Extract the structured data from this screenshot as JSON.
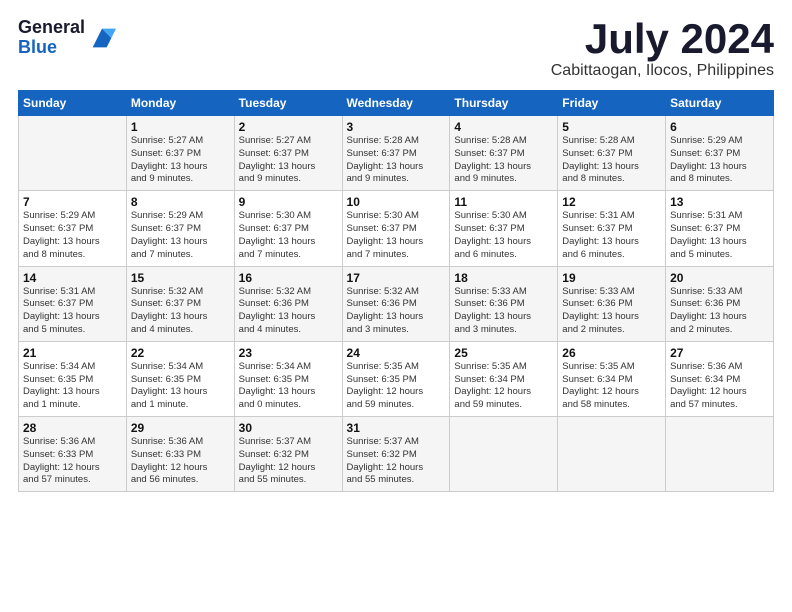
{
  "logo": {
    "general": "General",
    "blue": "Blue"
  },
  "title": "July 2024",
  "subtitle": "Cabittaogan, Ilocos, Philippines",
  "headers": [
    "Sunday",
    "Monday",
    "Tuesday",
    "Wednesday",
    "Thursday",
    "Friday",
    "Saturday"
  ],
  "weeks": [
    [
      {
        "num": "",
        "lines": []
      },
      {
        "num": "1",
        "lines": [
          "Sunrise: 5:27 AM",
          "Sunset: 6:37 PM",
          "Daylight: 13 hours",
          "and 9 minutes."
        ]
      },
      {
        "num": "2",
        "lines": [
          "Sunrise: 5:27 AM",
          "Sunset: 6:37 PM",
          "Daylight: 13 hours",
          "and 9 minutes."
        ]
      },
      {
        "num": "3",
        "lines": [
          "Sunrise: 5:28 AM",
          "Sunset: 6:37 PM",
          "Daylight: 13 hours",
          "and 9 minutes."
        ]
      },
      {
        "num": "4",
        "lines": [
          "Sunrise: 5:28 AM",
          "Sunset: 6:37 PM",
          "Daylight: 13 hours",
          "and 9 minutes."
        ]
      },
      {
        "num": "5",
        "lines": [
          "Sunrise: 5:28 AM",
          "Sunset: 6:37 PM",
          "Daylight: 13 hours",
          "and 8 minutes."
        ]
      },
      {
        "num": "6",
        "lines": [
          "Sunrise: 5:29 AM",
          "Sunset: 6:37 PM",
          "Daylight: 13 hours",
          "and 8 minutes."
        ]
      }
    ],
    [
      {
        "num": "7",
        "lines": [
          "Sunrise: 5:29 AM",
          "Sunset: 6:37 PM",
          "Daylight: 13 hours",
          "and 8 minutes."
        ]
      },
      {
        "num": "8",
        "lines": [
          "Sunrise: 5:29 AM",
          "Sunset: 6:37 PM",
          "Daylight: 13 hours",
          "and 7 minutes."
        ]
      },
      {
        "num": "9",
        "lines": [
          "Sunrise: 5:30 AM",
          "Sunset: 6:37 PM",
          "Daylight: 13 hours",
          "and 7 minutes."
        ]
      },
      {
        "num": "10",
        "lines": [
          "Sunrise: 5:30 AM",
          "Sunset: 6:37 PM",
          "Daylight: 13 hours",
          "and 7 minutes."
        ]
      },
      {
        "num": "11",
        "lines": [
          "Sunrise: 5:30 AM",
          "Sunset: 6:37 PM",
          "Daylight: 13 hours",
          "and 6 minutes."
        ]
      },
      {
        "num": "12",
        "lines": [
          "Sunrise: 5:31 AM",
          "Sunset: 6:37 PM",
          "Daylight: 13 hours",
          "and 6 minutes."
        ]
      },
      {
        "num": "13",
        "lines": [
          "Sunrise: 5:31 AM",
          "Sunset: 6:37 PM",
          "Daylight: 13 hours",
          "and 5 minutes."
        ]
      }
    ],
    [
      {
        "num": "14",
        "lines": [
          "Sunrise: 5:31 AM",
          "Sunset: 6:37 PM",
          "Daylight: 13 hours",
          "and 5 minutes."
        ]
      },
      {
        "num": "15",
        "lines": [
          "Sunrise: 5:32 AM",
          "Sunset: 6:37 PM",
          "Daylight: 13 hours",
          "and 4 minutes."
        ]
      },
      {
        "num": "16",
        "lines": [
          "Sunrise: 5:32 AM",
          "Sunset: 6:36 PM",
          "Daylight: 13 hours",
          "and 4 minutes."
        ]
      },
      {
        "num": "17",
        "lines": [
          "Sunrise: 5:32 AM",
          "Sunset: 6:36 PM",
          "Daylight: 13 hours",
          "and 3 minutes."
        ]
      },
      {
        "num": "18",
        "lines": [
          "Sunrise: 5:33 AM",
          "Sunset: 6:36 PM",
          "Daylight: 13 hours",
          "and 3 minutes."
        ]
      },
      {
        "num": "19",
        "lines": [
          "Sunrise: 5:33 AM",
          "Sunset: 6:36 PM",
          "Daylight: 13 hours",
          "and 2 minutes."
        ]
      },
      {
        "num": "20",
        "lines": [
          "Sunrise: 5:33 AM",
          "Sunset: 6:36 PM",
          "Daylight: 13 hours",
          "and 2 minutes."
        ]
      }
    ],
    [
      {
        "num": "21",
        "lines": [
          "Sunrise: 5:34 AM",
          "Sunset: 6:35 PM",
          "Daylight: 13 hours",
          "and 1 minute."
        ]
      },
      {
        "num": "22",
        "lines": [
          "Sunrise: 5:34 AM",
          "Sunset: 6:35 PM",
          "Daylight: 13 hours",
          "and 1 minute."
        ]
      },
      {
        "num": "23",
        "lines": [
          "Sunrise: 5:34 AM",
          "Sunset: 6:35 PM",
          "Daylight: 13 hours",
          "and 0 minutes."
        ]
      },
      {
        "num": "24",
        "lines": [
          "Sunrise: 5:35 AM",
          "Sunset: 6:35 PM",
          "Daylight: 12 hours",
          "and 59 minutes."
        ]
      },
      {
        "num": "25",
        "lines": [
          "Sunrise: 5:35 AM",
          "Sunset: 6:34 PM",
          "Daylight: 12 hours",
          "and 59 minutes."
        ]
      },
      {
        "num": "26",
        "lines": [
          "Sunrise: 5:35 AM",
          "Sunset: 6:34 PM",
          "Daylight: 12 hours",
          "and 58 minutes."
        ]
      },
      {
        "num": "27",
        "lines": [
          "Sunrise: 5:36 AM",
          "Sunset: 6:34 PM",
          "Daylight: 12 hours",
          "and 57 minutes."
        ]
      }
    ],
    [
      {
        "num": "28",
        "lines": [
          "Sunrise: 5:36 AM",
          "Sunset: 6:33 PM",
          "Daylight: 12 hours",
          "and 57 minutes."
        ]
      },
      {
        "num": "29",
        "lines": [
          "Sunrise: 5:36 AM",
          "Sunset: 6:33 PM",
          "Daylight: 12 hours",
          "and 56 minutes."
        ]
      },
      {
        "num": "30",
        "lines": [
          "Sunrise: 5:37 AM",
          "Sunset: 6:32 PM",
          "Daylight: 12 hours",
          "and 55 minutes."
        ]
      },
      {
        "num": "31",
        "lines": [
          "Sunrise: 5:37 AM",
          "Sunset: 6:32 PM",
          "Daylight: 12 hours",
          "and 55 minutes."
        ]
      },
      {
        "num": "",
        "lines": []
      },
      {
        "num": "",
        "lines": []
      },
      {
        "num": "",
        "lines": []
      }
    ]
  ]
}
